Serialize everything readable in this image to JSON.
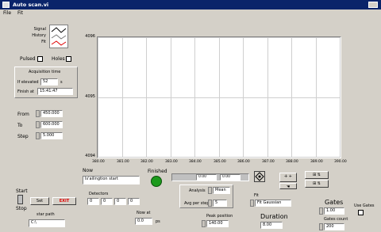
{
  "window": {
    "title": "Auto scan.vi"
  },
  "menu": [
    "File",
    "Fit"
  ],
  "legend": {
    "items": [
      "Signal",
      "History",
      "Fit"
    ]
  },
  "checks": {
    "pulsed_label": "Pulsed",
    "holes_label": "Holes"
  },
  "acquisition": {
    "title": "Acquisition time",
    "elapsed_label": "If elevated",
    "elapsed_value": "52",
    "elapsed_unit": "s",
    "finish_label": "Finish at",
    "finish_value": "15:41:47"
  },
  "scan": {
    "from_label": "From",
    "from_value": "450.000",
    "to_label": "To",
    "to_value": "600.000",
    "step_label": "Step",
    "step_value": "5.000"
  },
  "chart_data": {
    "type": "line",
    "y_ticks": [
      "4096",
      "4095",
      "4094"
    ],
    "x_ticks": [
      "380.00",
      "381.00",
      "382.00",
      "383.00",
      "384.00",
      "385.00",
      "386.00",
      "387.00",
      "388.00",
      "389.00",
      "390.00"
    ],
    "grid": true,
    "series": []
  },
  "status": {
    "now_label": "Now",
    "now_value": "Is'ailingtion start",
    "finished_label": "Finished"
  },
  "progress": {
    "left_value": "0.00",
    "right_value": "0.00"
  },
  "analysis": {
    "label": "Analysis",
    "value": "Mean",
    "avg_label": "Avg per step",
    "avg_value": "5"
  },
  "fit": {
    "label": "Fit",
    "value": "Fit Gaussian"
  },
  "controls": {
    "start_label": "Start",
    "stop_label": "Stop",
    "set_label": "Set",
    "exit_label": "EXIT"
  },
  "detectors": {
    "label": "Detectors",
    "values": [
      "0",
      "0",
      "0",
      "0"
    ]
  },
  "path": {
    "label": "star path",
    "value": "C:\\"
  },
  "now_at": {
    "label": "Now at",
    "value": "0.0",
    "unit": "ps"
  },
  "peak": {
    "label": "Peak position",
    "value": "140.00"
  },
  "duration": {
    "label": "Duration",
    "value": "8.00"
  },
  "gates": {
    "label": "Gates",
    "value": "1.00",
    "count_label": "Gates count",
    "count_value": "200",
    "use_label": "Use Gates"
  }
}
